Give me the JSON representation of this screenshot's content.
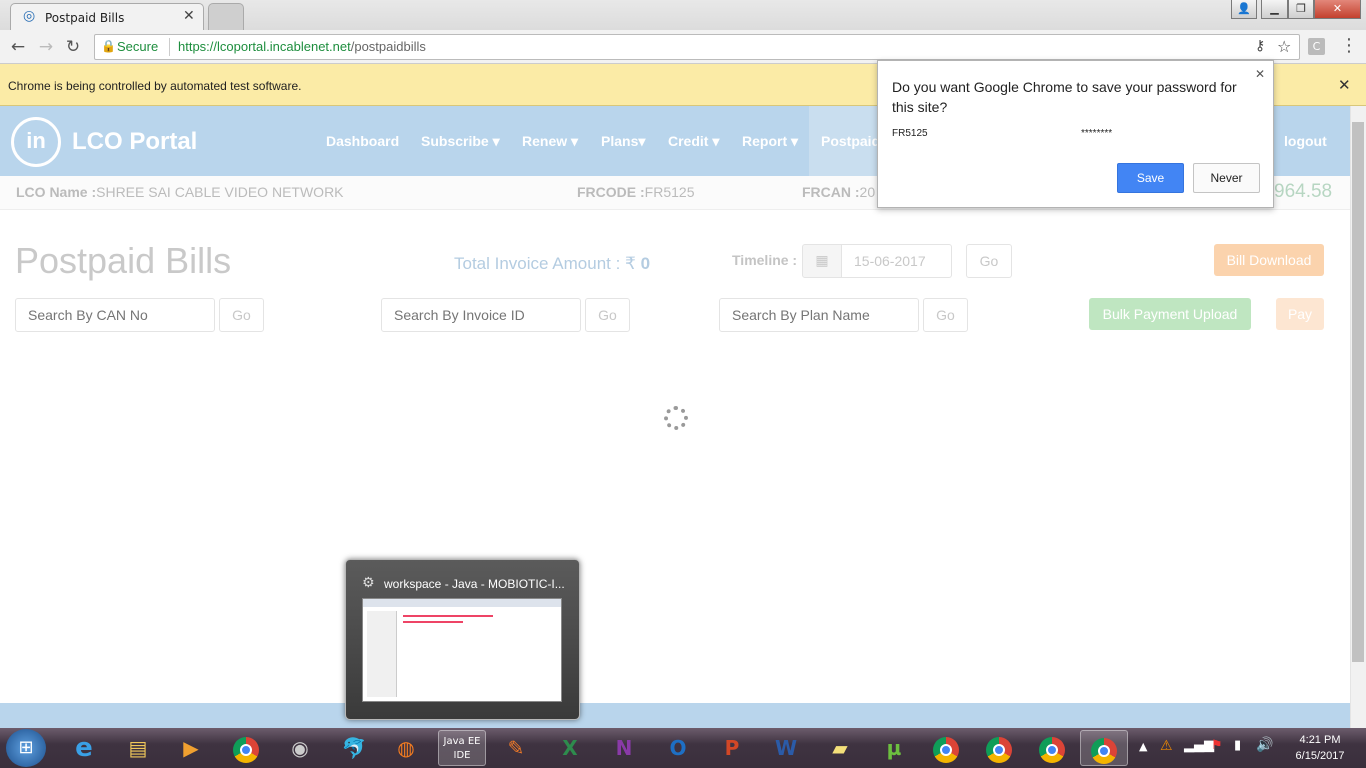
{
  "browser": {
    "tab_title": "Postpaid Bills",
    "secure_label": "Secure",
    "url_base": "https://lcoportal.incablenet.net",
    "url_path": "/postpaidbills",
    "infobar_text": "Chrome is being controlled by automated test software."
  },
  "site": {
    "brand": "LCO Portal",
    "nav": [
      "Dashboard",
      "Subscribe ▾",
      "Renew ▾",
      "Plans▾",
      "Credit ▾",
      "Report ▾",
      "Postpaid",
      "logout"
    ],
    "lco_name_label": "LCO Name :",
    "lco_name_value": "SHREE SAI CABLE VIDEO NETWORK",
    "frcode_label": "FRCODE :",
    "frcode_value": "FR5125",
    "frcan_label": "FRCAN :",
    "frcan_value": "20",
    "balance_partial": "964.58",
    "page_title": "Postpaid Bills",
    "total_label": "Total Invoice Amount : ₹",
    "total_value": "0",
    "timeline_label": "Timeline :",
    "timeline_date": "15-06-2017",
    "go_label": "Go",
    "bill_download": "Bill Download",
    "search_can_placeholder": "Search By CAN No",
    "search_invoice_placeholder": "Search By Invoice ID",
    "search_plan_placeholder": "Search By Plan Name",
    "bulk_payment": "Bulk Payment Upload",
    "pay": "Pay"
  },
  "password_prompt": {
    "question": "Do you want Google Chrome to save your password for this site?",
    "username": "FR5125",
    "password_mask": "********",
    "save_label": "Save",
    "never_label": "Never"
  },
  "preview": {
    "title": "workspace - Java - MOBIOTIC-I..."
  },
  "taskbar": {
    "time": "4:21 PM",
    "date": "6/15/2017"
  },
  "colors": {
    "header": "#b9d5ec",
    "infobar": "#fbeba6",
    "save_button": "#4285f4",
    "bill_download": "#fbd3ad",
    "bulk_payment": "#bfe6c1",
    "pay": "#fde6d2"
  }
}
